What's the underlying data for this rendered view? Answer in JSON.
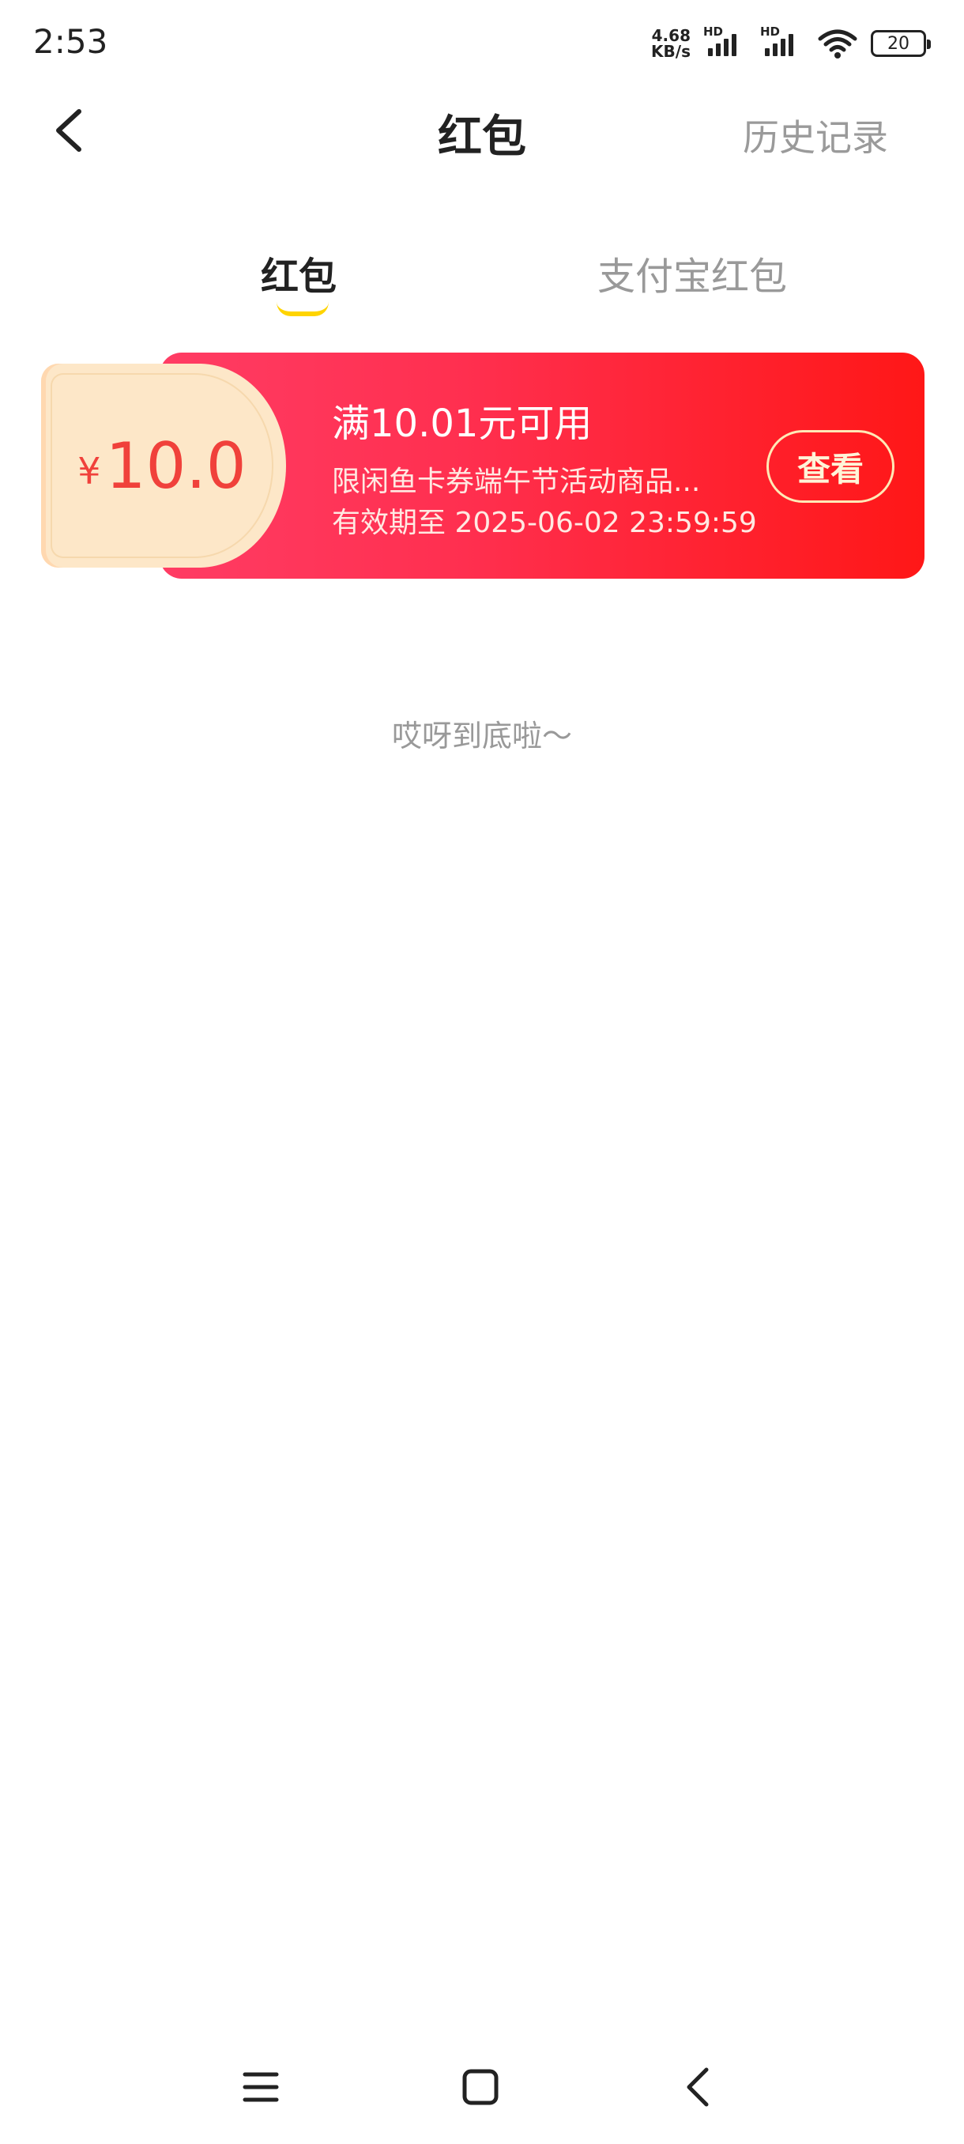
{
  "status_bar": {
    "time": "2:53",
    "net_speed_value": "4.68",
    "net_speed_unit": "KB/s",
    "signal_label_1": "HD",
    "signal_label_2": "HD",
    "battery": "20"
  },
  "header": {
    "title": "红包",
    "history_label": "历史记录"
  },
  "tabs": [
    {
      "label": "红包",
      "active": true
    },
    {
      "label": "支付宝红包",
      "active": false
    }
  ],
  "coupon": {
    "currency": "¥",
    "amount": "10.0",
    "title": "满10.01元可用",
    "description": "限闲鱼卡券端午节活动商品...",
    "expiry": "有效期至 2025-06-02 23:59:59",
    "button_label": "查看"
  },
  "list_end_text": "哎呀到底啦～",
  "colors": {
    "accent_red": "#ff1f3d",
    "coupon_amount": "#f0413b",
    "tab_indicator": "#ffd400"
  }
}
